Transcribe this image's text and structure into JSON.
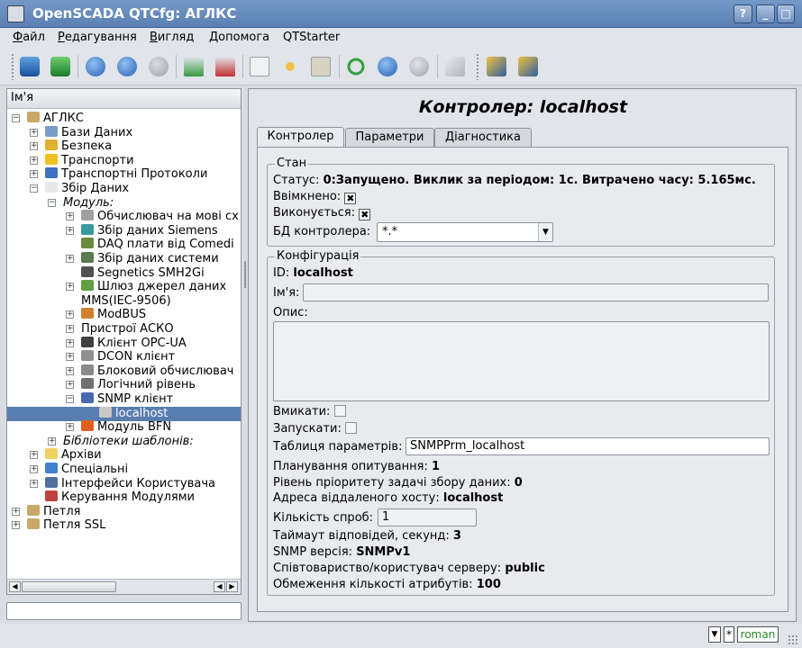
{
  "window": {
    "title": "OpenSCADA QTCfg: АГЛКС"
  },
  "menu": [
    {
      "label": "Файл",
      "mnemonic": "Ф"
    },
    {
      "label": "Редагування",
      "mnemonic": "Р"
    },
    {
      "label": "Вигляд",
      "mnemonic": "В"
    },
    {
      "label": "Допомога",
      "mnemonic": "Д"
    },
    {
      "label": "QTStarter",
      "mnemonic": ""
    }
  ],
  "toolbar_icons": [
    "db-load-icon",
    "db-save-icon",
    "up-icon",
    "back-icon",
    "forward-icon",
    "add-item-icon",
    "delete-item-icon",
    "copy-icon",
    "cut-icon",
    "paste-icon",
    "refresh-icon",
    "start-icon",
    "stop-icon",
    "info-icon",
    "module-tool-icon",
    "module-tool2-icon"
  ],
  "tree": {
    "header": "Ім'я",
    "nodes": [
      {
        "label": "АГЛКС",
        "level": 0,
        "exp": "-",
        "icon": "#c9a86a"
      },
      {
        "label": "Бази Даних",
        "level": 1,
        "exp": "+",
        "icon": "#7a9cc8"
      },
      {
        "label": "Безпека",
        "level": 1,
        "exp": "+",
        "icon": "#e0b030"
      },
      {
        "label": "Транспорти",
        "level": 1,
        "exp": "+",
        "icon": "#f0c020"
      },
      {
        "label": "Транспортні Протоколи",
        "level": 1,
        "exp": "+",
        "icon": "#4070c0"
      },
      {
        "label": "Збір Даних",
        "level": 1,
        "exp": "-",
        "icon": "#e8e8e8"
      },
      {
        "label": "Модуль:",
        "level": 2,
        "exp": "-",
        "icon": "",
        "italic": true
      },
      {
        "label": "Обчислювач на мові сх",
        "level": 3,
        "exp": "+",
        "icon": "#a0a0a0"
      },
      {
        "label": "Збір даних Siemens",
        "level": 3,
        "exp": "+",
        "icon": "#3a9a9a"
      },
      {
        "label": "DAQ плати від Comedi",
        "level": 3,
        "exp": "",
        "icon": "#6a8a40"
      },
      {
        "label": "Збір даних системи",
        "level": 3,
        "exp": "+",
        "icon": "#5a7a50"
      },
      {
        "label": "Segnetics SMH2Gi",
        "level": 3,
        "exp": "",
        "icon": "#505050"
      },
      {
        "label": "Шлюз джерел даних",
        "level": 3,
        "exp": "+",
        "icon": "#60a040"
      },
      {
        "label": "MMS(IEC-9506)",
        "level": 3,
        "exp": "",
        "icon": ""
      },
      {
        "label": "ModBUS",
        "level": 3,
        "exp": "+",
        "icon": "#d08030"
      },
      {
        "label": "Пристрої АСКО",
        "level": 3,
        "exp": "+",
        "icon": ""
      },
      {
        "label": "Клієнт OPC-UA",
        "level": 3,
        "exp": "+",
        "icon": "#404040"
      },
      {
        "label": "DCON клієнт",
        "level": 3,
        "exp": "+",
        "icon": "#909090"
      },
      {
        "label": "Блоковий обчислювач",
        "level": 3,
        "exp": "+",
        "icon": "#8a8a8a"
      },
      {
        "label": "Логічний рівень",
        "level": 3,
        "exp": "+",
        "icon": "#707070"
      },
      {
        "label": "SNMP клієнт",
        "level": 3,
        "exp": "-",
        "icon": "#4a6ab0"
      },
      {
        "label": "localhost",
        "level": 4,
        "exp": "",
        "icon": "#c8c8c8",
        "selected": true
      },
      {
        "label": "Модуль BFN",
        "level": 3,
        "exp": "+",
        "icon": "#e06020"
      },
      {
        "label": "Бібліотеки шаблонів:",
        "level": 2,
        "exp": "+",
        "icon": "",
        "italic": true
      },
      {
        "label": "Архіви",
        "level": 1,
        "exp": "+",
        "icon": "#f0d060"
      },
      {
        "label": "Спеціальні",
        "level": 1,
        "exp": "+",
        "icon": "#4080d0"
      },
      {
        "label": "Інтерфейси Користувача",
        "level": 1,
        "exp": "+",
        "icon": "#5070a0"
      },
      {
        "label": "Керування Модулями",
        "level": 1,
        "exp": "",
        "icon": "#c04040"
      },
      {
        "label": "Петля",
        "level": 0,
        "exp": "+",
        "icon": "#c9a86a"
      },
      {
        "label": "Петля SSL",
        "level": 0,
        "exp": "+",
        "icon": "#c9a86a"
      }
    ]
  },
  "controller": {
    "title": "Контролер: localhost",
    "tabs": [
      "Контролер",
      "Параметри",
      "Діагностика"
    ],
    "state": {
      "group": "Стан",
      "status_label": "Статус:",
      "status_value": "0:Запущено. Виклик за періодом: 1с. Витрачено часу: 5.165мс.",
      "enabled_label": "Ввімкнено:",
      "enabled": true,
      "running_label": "Виконується:",
      "running": true,
      "db_label": "БД контролера:",
      "db_value": "*.*"
    },
    "config": {
      "group": "Конфігурація",
      "id_label": "ID:",
      "id_value": "localhost",
      "name_label": "Ім'я:",
      "name_value": "",
      "descr_label": "Опис:",
      "to_enable_label": "Вмикати:",
      "to_start_label": "Запускати:",
      "prm_table_label": "Таблиця параметрів:",
      "prm_table_value": "SNMPPrm_localhost",
      "schedule_label": "Планування опитування:",
      "schedule_value": "1",
      "priority_label": "Рівень пріоритету задачі збору даних:",
      "priority_value": "0",
      "addr_label": "Адреса віддаленого хосту:",
      "addr_value": "localhost",
      "retries_label": "Кількість спроб:",
      "retries_value": "1",
      "timeout_label": "Таймаут відповідей, секунд:",
      "timeout_value": "3",
      "version_label": "SNMP версія:",
      "version_value": "SNMPv1",
      "community_label": "Співтовариство/користувач серверу:",
      "community_value": "public",
      "attr_limit_label": "Обмеження кількості атрибутів:",
      "attr_limit_value": "100"
    }
  },
  "statusbar": {
    "asterisk": "*",
    "user": "roman"
  }
}
